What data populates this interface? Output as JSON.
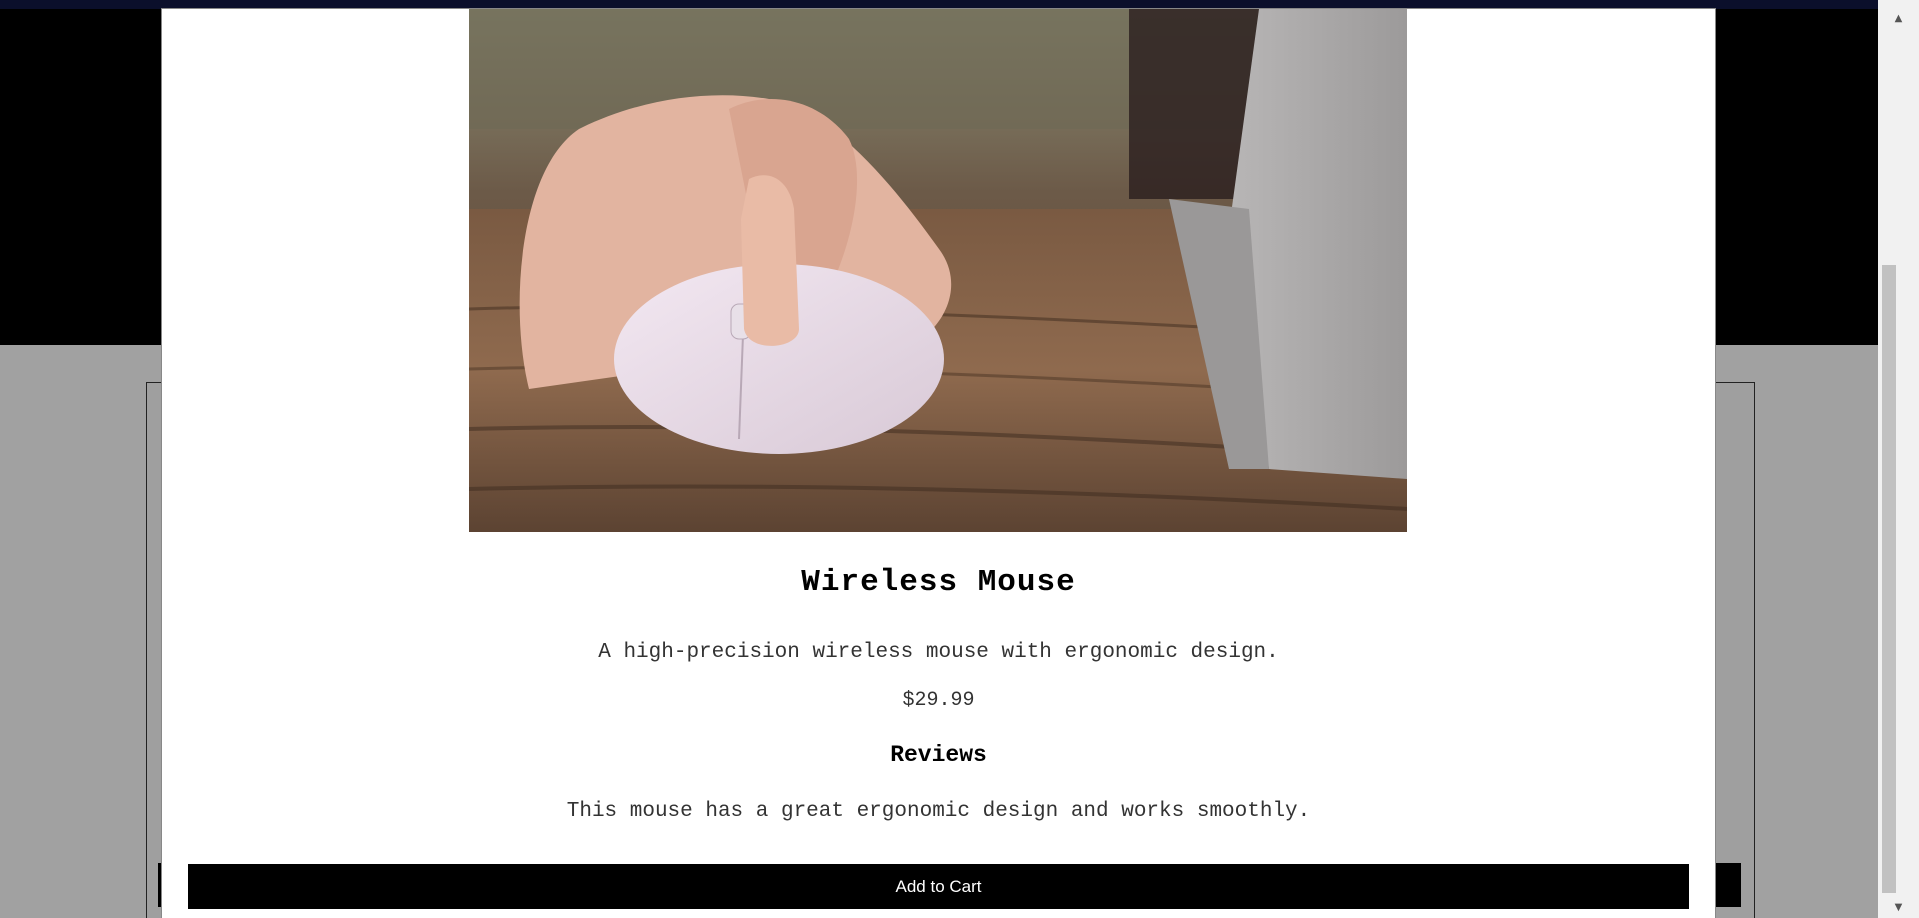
{
  "product": {
    "title": "Wireless Mouse",
    "description": "A high-precision wireless mouse with ergonomic design.",
    "price": "$29.99",
    "image_icon": "mouse-product-photo"
  },
  "reviews": {
    "heading": "Reviews",
    "items": [
      "This mouse has a great ergonomic design and works smoothly."
    ]
  },
  "actions": {
    "add_to_cart_label": "Add to Cart"
  },
  "colors": {
    "button_background": "#000000",
    "button_text": "#ffffff",
    "overlay": "#a1a1a1"
  }
}
